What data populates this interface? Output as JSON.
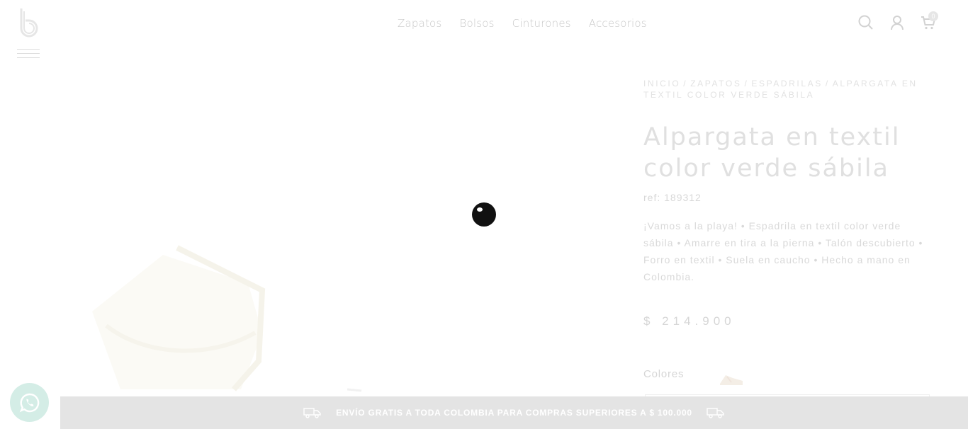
{
  "header": {
    "nav": [
      "Zapatos",
      "Bolsos",
      "Cinturones",
      "Accesorios"
    ],
    "cart_count": "0"
  },
  "breadcrumb": [
    "Inicio",
    "Zapatos",
    "Espadrilas",
    "Alpargata en textil color verde sábila"
  ],
  "product": {
    "title": "Alpargata en textil color verde sábila",
    "ref": "ref: 189312",
    "description": "¡Vamos a la playa! • Espadrila en textil color verde sábila • Amarre en tira a la pierna • Talón descubierto • Forro en textil • Suela en caucho • Hecho a mano en Colombia.",
    "price": "$ 214.900",
    "colors_label": "Colores"
  },
  "banner": {
    "text": "ENVÍO GRATIS A TODA COLOMBIA PARA COMPRAS SUPERIORES A $ 100.000"
  },
  "icons": {
    "logo": "brand-b-logo",
    "menu": "hamburger-icon",
    "search": "search-icon",
    "account": "user-icon",
    "cart": "cart-icon",
    "whatsapp": "whatsapp-icon",
    "shipping": "truck-icon",
    "loader": "loading-spinner"
  },
  "colors": {
    "text_faded": "#e0e0e0",
    "banner_bg": "#e4e4e4",
    "whatsapp_bg": "#d4ede6",
    "loader": "#111111"
  }
}
